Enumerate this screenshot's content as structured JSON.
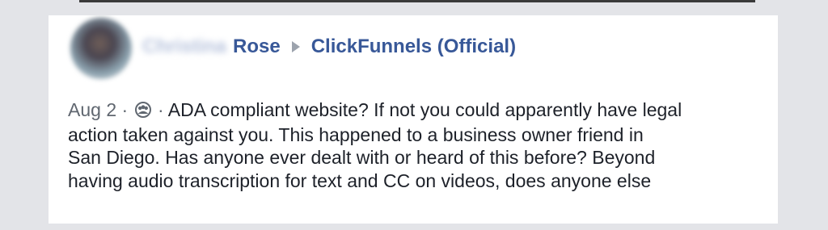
{
  "author": {
    "first_name_blurred": "Christina",
    "last_name": "Rose"
  },
  "group": {
    "name": "ClickFunnels (Official)"
  },
  "post": {
    "date": "Aug 2",
    "separator": "·",
    "audience_icon": "group-audience-icon",
    "lines": [
      "ADA compliant website? If not you could apparently have legal",
      "action taken against you. This happened to a business owner friend in",
      "San Diego. Has anyone ever dealt with or heard of this before? Beyond",
      "having audio transcription for text and CC on videos, does anyone else"
    ]
  },
  "colors": {
    "link": "#385898",
    "text": "#1d2129",
    "meta": "#606770",
    "background": "#e3e4e8"
  }
}
